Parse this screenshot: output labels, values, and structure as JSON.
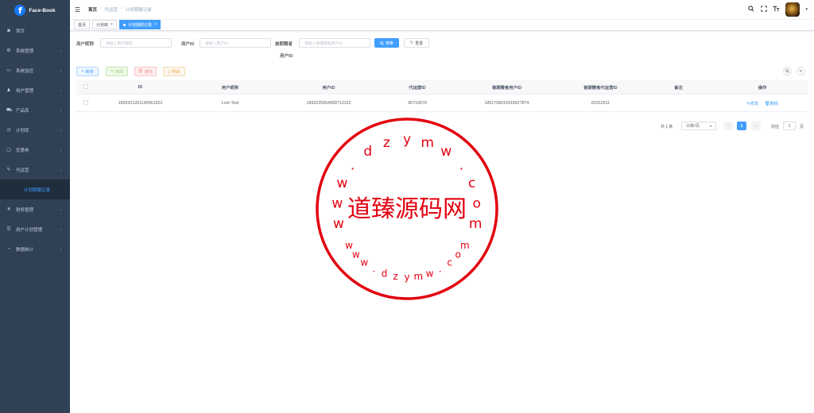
{
  "app": {
    "logo_letter": "f",
    "name": "Face-Book"
  },
  "sidebar": {
    "items": [
      {
        "label": "首页",
        "icon": "dashboard-icon",
        "glyph": "◙",
        "has_arrow": false
      },
      {
        "label": "系统管理",
        "icon": "gear-icon",
        "glyph": "⚙",
        "has_arrow": true
      },
      {
        "label": "系统监控",
        "icon": "monitor-icon",
        "glyph": "▭",
        "has_arrow": true
      },
      {
        "label": "用户管理",
        "icon": "user-icon",
        "glyph": "♟",
        "has_arrow": true
      },
      {
        "label": "产品库",
        "icon": "cart-icon",
        "glyph": "⛟",
        "has_arrow": true
      },
      {
        "label": "计划库",
        "icon": "clock-icon",
        "glyph": "◷",
        "has_arrow": true
      },
      {
        "label": "优惠券",
        "icon": "ticket-icon",
        "glyph": "▢",
        "has_arrow": true
      },
      {
        "label": "代运营",
        "icon": "tools-icon",
        "glyph": "✎",
        "has_arrow": true
      }
    ],
    "active_sub": "计划期赠记录",
    "items_after": [
      {
        "label": "财务管理",
        "icon": "yen-icon",
        "glyph": "¥",
        "has_arrow": true
      },
      {
        "label": "用户计划管理",
        "icon": "list-icon",
        "glyph": "☰",
        "has_arrow": true
      },
      {
        "label": "数据统计",
        "icon": "chart-icon",
        "glyph": "◔",
        "has_arrow": true
      }
    ]
  },
  "navbar": {
    "breadcrumb": [
      "首页",
      "代运营",
      "计划期赠记录"
    ],
    "separator": "/"
  },
  "tags": [
    {
      "label": "首页",
      "active": false,
      "closable": false
    },
    {
      "label": "计划库",
      "active": false,
      "closable": true
    },
    {
      "label": "计划期赠记录",
      "active": true,
      "closable": true
    }
  ],
  "search": {
    "fields": [
      {
        "label": "用户昵称",
        "placeholder": "请输入用户昵称"
      },
      {
        "label": "用户ID",
        "placeholder": "请输入用户ID"
      },
      {
        "label": "被期赠者",
        "label2": "用户ID",
        "placeholder": "请输入被期赠者用户ID"
      }
    ],
    "search_label": "搜索",
    "reset_label": "重置"
  },
  "toolbar": {
    "add_label": "新增",
    "edit_label": "修改",
    "delete_label": "删除",
    "export_label": "导出"
  },
  "table": {
    "columns": [
      "ID",
      "用户昵称",
      "用户ID",
      "代运营ID",
      "被期赠者用户ID",
      "被期赠者代运营ID",
      "备注",
      "操作"
    ],
    "rows": [
      {
        "id": "1893321261140561922",
        "nickname": "Lom Tost",
        "user_id": "1893225664689713153",
        "agent_id": "90719578",
        "receiver_user_id": "1891758014318927874",
        "receiver_agent_id": "83152911",
        "remark": "",
        "edit_label": "修改",
        "delete_label": "删除"
      }
    ]
  },
  "pagination": {
    "total": "共 1 条",
    "page_size": "10条/页",
    "prev": "<",
    "current_page": "1",
    "next": ">",
    "goto_label": "前往",
    "goto_value": "1",
    "page_suffix": "页"
  },
  "watermark": {
    "center_text": "道臻源码网",
    "top_arc": [
      "w",
      "w",
      "w",
      ".",
      "d",
      "z",
      "y",
      "m",
      "w",
      ".",
      "c",
      "o",
      "m"
    ],
    "bottom_arc": [
      "w",
      "w",
      "w",
      ".",
      "d",
      "z",
      "y",
      "m",
      "w",
      ".",
      "c",
      "o",
      "m"
    ],
    "color": "#e3000f"
  },
  "colors": {
    "primary": "#409eff",
    "sidebar_bg": "#304156",
    "sidebar_sub_bg": "#1f2d3d"
  }
}
